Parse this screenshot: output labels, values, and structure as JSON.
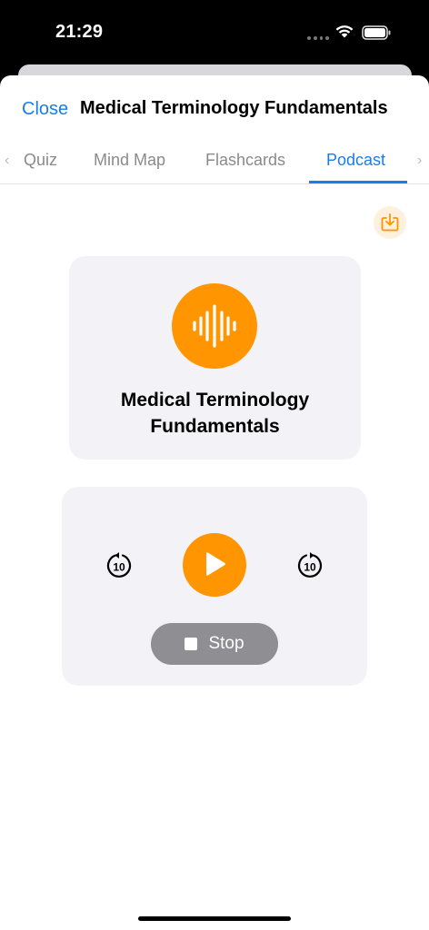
{
  "status_bar": {
    "time": "21:29",
    "wifi_icon": "wifi-icon",
    "battery_icon": "battery-icon"
  },
  "header": {
    "close_label": "Close",
    "title": "Medical Terminology Fundamentals"
  },
  "tabs": {
    "items": [
      {
        "label": "Quiz",
        "active": false
      },
      {
        "label": "Mind Map",
        "active": false
      },
      {
        "label": "Flashcards",
        "active": false
      },
      {
        "label": "Podcast",
        "active": true
      }
    ],
    "left_chevron": "‹",
    "right_chevron": "›"
  },
  "toolbar": {
    "download_icon": "download-icon"
  },
  "cover": {
    "icon": "waveform-icon",
    "title": "Medical Terminology Fundamentals"
  },
  "player": {
    "skip_back_seconds": "10",
    "skip_forward_seconds": "10",
    "play_icon": "play-icon",
    "stop_label": "Stop"
  },
  "colors": {
    "accent_blue": "#1a7ee6",
    "accent_orange": "#ff9500",
    "card_bg": "#f2f2f7",
    "stop_bg": "#8e8e93"
  }
}
